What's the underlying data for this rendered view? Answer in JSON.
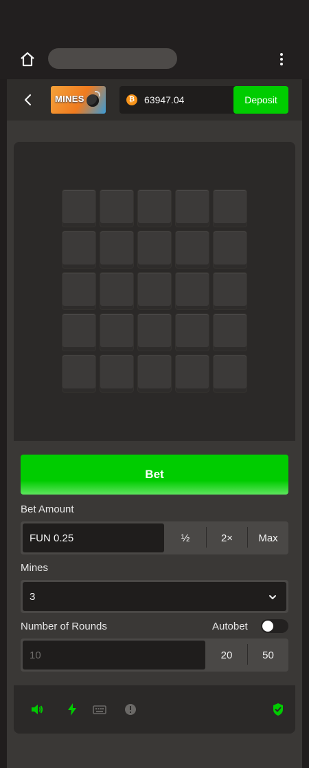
{
  "browser": {
    "home_icon": "home-icon",
    "menu_icon": "kebab-menu-icon"
  },
  "header": {
    "back_icon": "chevron-left-icon",
    "logo_text": "MINES",
    "currency_icon": "bitcoin-icon",
    "currency_glyph": "₿",
    "balance": "63947.04",
    "deposit_label": "Deposit"
  },
  "board": {
    "rows": 5,
    "cols": 5
  },
  "controls": {
    "bet_label": "Bet",
    "bet_amount_label": "Bet Amount",
    "bet_amount_value": "FUN 0.25",
    "half_label": "½",
    "double_label": "2×",
    "max_label": "Max",
    "mines_label": "Mines",
    "mines_value": "3",
    "rounds_label": "Number of Rounds",
    "rounds_placeholder": "10",
    "rounds_20": "20",
    "rounds_50": "50",
    "autobet_label": "Autobet",
    "autobet_on": false
  },
  "footer": {
    "icons": [
      "volume-icon",
      "lightning-icon",
      "keyboard-icon",
      "info-icon",
      "shield-check-icon"
    ]
  },
  "colors": {
    "accent": "#00cc00",
    "background": "#3a3836",
    "panel": "#2b2928"
  }
}
